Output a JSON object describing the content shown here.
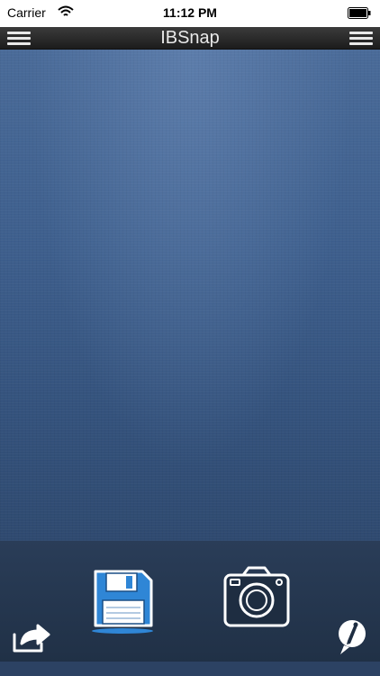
{
  "status_bar": {
    "carrier": "Carrier",
    "time": "11:12 PM",
    "wifi_icon": "wifi-icon",
    "battery_icon": "battery-icon"
  },
  "nav_bar": {
    "title": "IBSnap",
    "left_icon": "hamburger-menu-icon",
    "right_icon": "hamburger-menu-icon"
  },
  "toolbar": {
    "save_icon": "floppy-disk-icon",
    "camera_icon": "camera-icon",
    "share_icon": "share-arrow-icon",
    "info_icon": "info-pencil-icon"
  },
  "colors": {
    "nav_background": "#2b2b2b",
    "canvas_blue": "#3e5f8d",
    "toolbar_background": "#24354d",
    "accent_blue": "#2f86d6"
  }
}
